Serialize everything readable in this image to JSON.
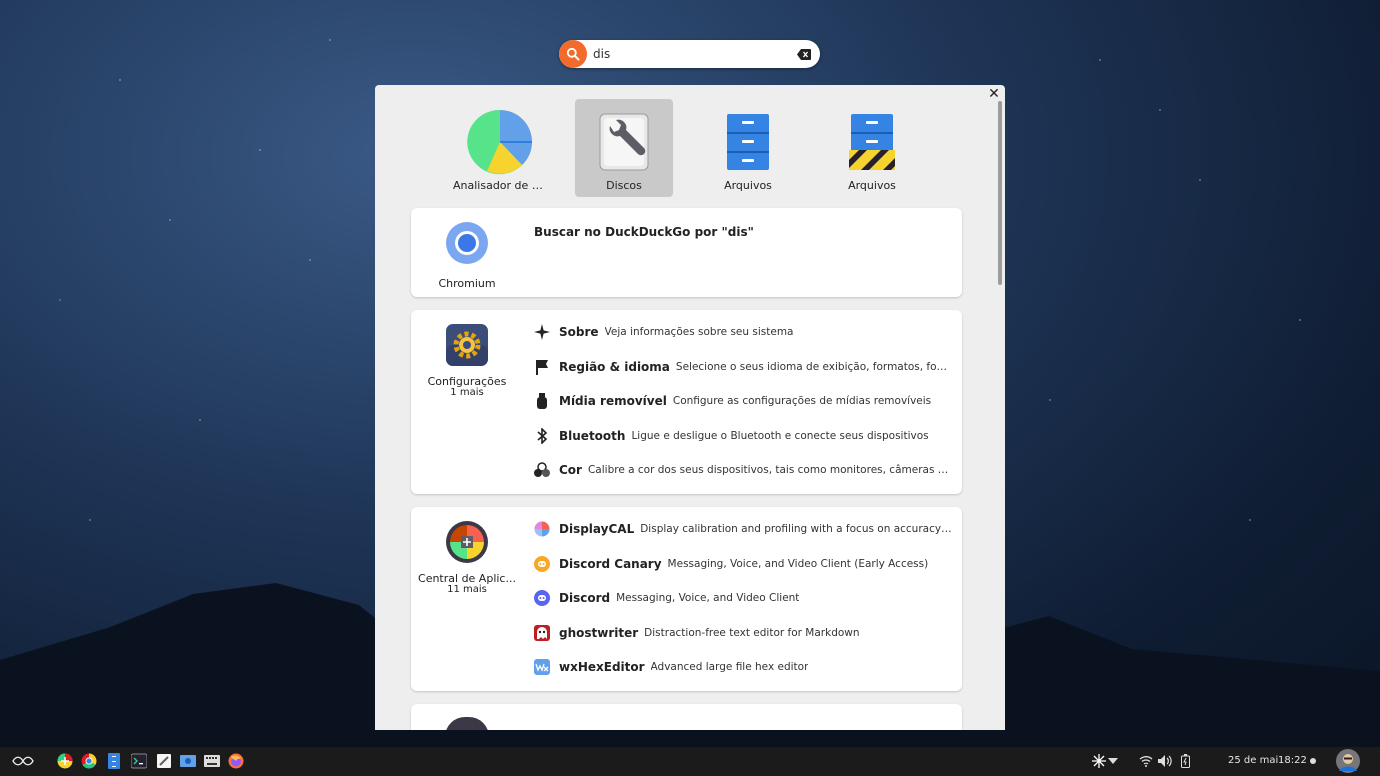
{
  "search": {
    "value": "dis",
    "placeholder": ""
  },
  "top_apps": [
    {
      "label": "Analisador de us..."
    },
    {
      "label": "Discos"
    },
    {
      "label": "Arquivos"
    },
    {
      "label": "Arquivos"
    }
  ],
  "web_card": {
    "app_name": "Chromium",
    "text": "Buscar no DuckDuckGo por \"dis\""
  },
  "settings_card": {
    "app_name": "Configurações",
    "more": "1 mais",
    "rows": [
      {
        "title": "Sobre",
        "desc": "Veja informações sobre seu sistema",
        "icon": "star-icon"
      },
      {
        "title": "Região & idioma",
        "desc": "Selecione o seus idioma de exibição, formatos, fontes de entr...",
        "icon": "flag-icon"
      },
      {
        "title": "Mídia removível",
        "desc": "Configure as configurações de mídias removíveis",
        "icon": "usb-icon"
      },
      {
        "title": "Bluetooth",
        "desc": "Ligue e desligue o Bluetooth e conecte seus dispositivos",
        "icon": "bluetooth-icon"
      },
      {
        "title": "Cor",
        "desc": "Calibre a cor dos seus dispositivos, tais como monitores, câmeras ou impresso...",
        "icon": "color-icon"
      }
    ]
  },
  "software_card": {
    "app_name": "Central de Aplic...",
    "more": "11 mais",
    "rows": [
      {
        "title": "DisplayCAL",
        "desc": "Display calibration and profiling with a focus on accuracy and versati...",
        "icon": "displaycal-icon"
      },
      {
        "title": "Discord Canary",
        "desc": "Messaging, Voice, and Video Client (Early Access)",
        "icon": "discord-canary-icon"
      },
      {
        "title": "Discord",
        "desc": "Messaging, Voice, and Video Client",
        "icon": "discord-icon"
      },
      {
        "title": "ghostwriter",
        "desc": "Distraction-free text editor for Markdown",
        "icon": "ghostwriter-icon"
      },
      {
        "title": "wxHexEditor",
        "desc": "Advanced large file hex editor",
        "icon": "wxhexeditor-icon"
      }
    ]
  },
  "taskbar": {
    "date": "25 de mai",
    "time": "18:22"
  },
  "colors": {
    "accent": "#f26b2a",
    "panel_bg": "#eeeeef",
    "selected_bg": "#c9c9c9",
    "taskbar_bg": "#1b1b1b"
  }
}
